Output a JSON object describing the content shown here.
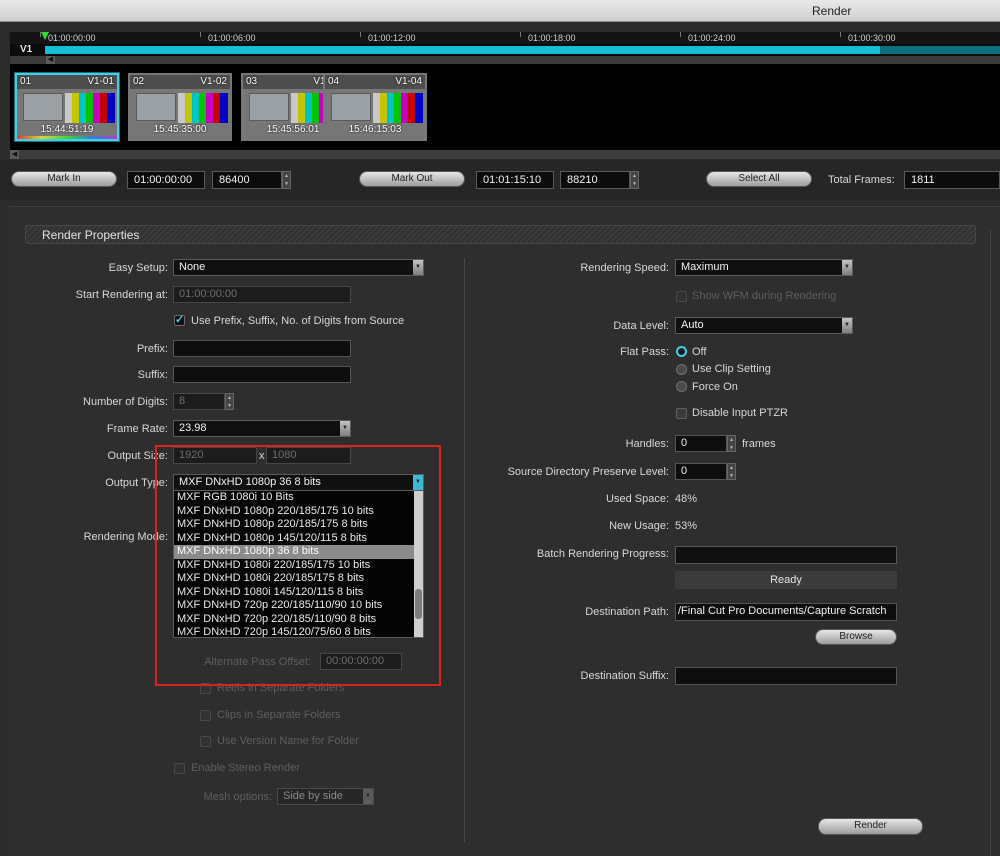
{
  "window": {
    "title": "Render"
  },
  "timeline": {
    "track_label": "V1",
    "timecodes": [
      "01:00:00:00",
      "01:00:06:00",
      "01:00:12:00",
      "01:00:18:00",
      "01:00:24:00",
      "01:00:30:00"
    ]
  },
  "clips": [
    {
      "num": "01",
      "name": "V1-01",
      "tc": "15:44:51:19"
    },
    {
      "num": "02",
      "name": "V1-02",
      "tc": "15:45:35:00"
    },
    {
      "num": "03",
      "name": "V1-03",
      "tc": "15:45:56:01"
    },
    {
      "num": "04",
      "name": "V1-04",
      "tc": "15:46:15:03"
    }
  ],
  "marks": {
    "mark_in_label": "Mark In",
    "mark_in_tc": "01:00:00:00",
    "mark_in_frames": "86400",
    "mark_out_label": "Mark Out",
    "mark_out_tc": "01:01:15:10",
    "mark_out_frames": "88210",
    "select_all_label": "Select All",
    "total_frames_label": "Total Frames:",
    "total_frames": "1811"
  },
  "props": {
    "header": "Render Properties",
    "easy_setup_label": "Easy Setup:",
    "easy_setup_value": "None",
    "start_label": "Start Rendering at:",
    "start_value": "01:00:00:00",
    "use_prefix_label": "Use Prefix, Suffix, No. of Digits from Source",
    "prefix_label": "Prefix:",
    "suffix_label": "Suffix:",
    "digits_label": "Number of Digits:",
    "digits_value": "8",
    "frame_rate_label": "Frame Rate:",
    "frame_rate_value": "23.98",
    "output_size_label": "Output Size:",
    "output_w": "1920",
    "output_x": "x",
    "output_h": "1080",
    "output_type_label": "Output Type:",
    "output_type_value": "MXF DNxHD 1080p 36 8 bits",
    "rendering_mode_label": "Rendering Mode:",
    "alt_pass_label": "Alternate Pass Offset:",
    "alt_pass_value": "00:00:00:00",
    "reels_label": "Reels in Separate Folders",
    "clips_label": "Clips in Separate Folders",
    "version_label": "Use Version Name for Folder",
    "stereo_label": "Enable Stereo Render",
    "mesh_label": "Mesh options:",
    "mesh_value": "Side by side",
    "output_options": [
      "MXF RGB 1080i 10 Bits",
      "MXF DNxHD 1080p 220/185/175 10 bits",
      "MXF DNxHD 1080p 220/185/175 8 bits",
      "MXF DNxHD 1080p 145/120/115 8 bits",
      "MXF DNxHD 1080p 36 8 bits",
      "MXF DNxHD 1080i 220/185/175 10 bits",
      "MXF DNxHD 1080i 220/185/175 8 bits",
      "MXF DNxHD 1080i 145/120/115 8 bits",
      "MXF DNxHD 720p 220/185/110/90 10 bits",
      "MXF DNxHD 720p 220/185/110/90 8 bits",
      "MXF DNxHD 720p 145/120/75/60 8 bits"
    ],
    "speed_label": "Rendering Speed:",
    "speed_value": "Maximum",
    "show_wfm_label": "Show WFM during Rendering",
    "data_level_label": "Data Level:",
    "data_level_value": "Auto",
    "flat_pass_label": "Flat Pass:",
    "flat_off": "Off",
    "flat_clip": "Use Clip Setting",
    "flat_force": "Force On",
    "disable_ptzr_label": "Disable Input PTZR",
    "handles_label": "Handles:",
    "handles_value": "0",
    "handles_unit": "frames",
    "src_dir_label": "Source Directory Preserve Level:",
    "src_dir_value": "0",
    "used_space_label": "Used Space:",
    "used_space_value": "48%",
    "new_usage_label": "New Usage:",
    "new_usage_value": "53%",
    "batch_label": "Batch Rendering Progress:",
    "status": "Ready",
    "dest_path_label": "Destination Path:",
    "dest_path_value": "/Final Cut Pro Documents/Capture Scratch",
    "browse_label": "Browse",
    "dest_suffix_label": "Destination Suffix:",
    "render_label": "Render"
  }
}
